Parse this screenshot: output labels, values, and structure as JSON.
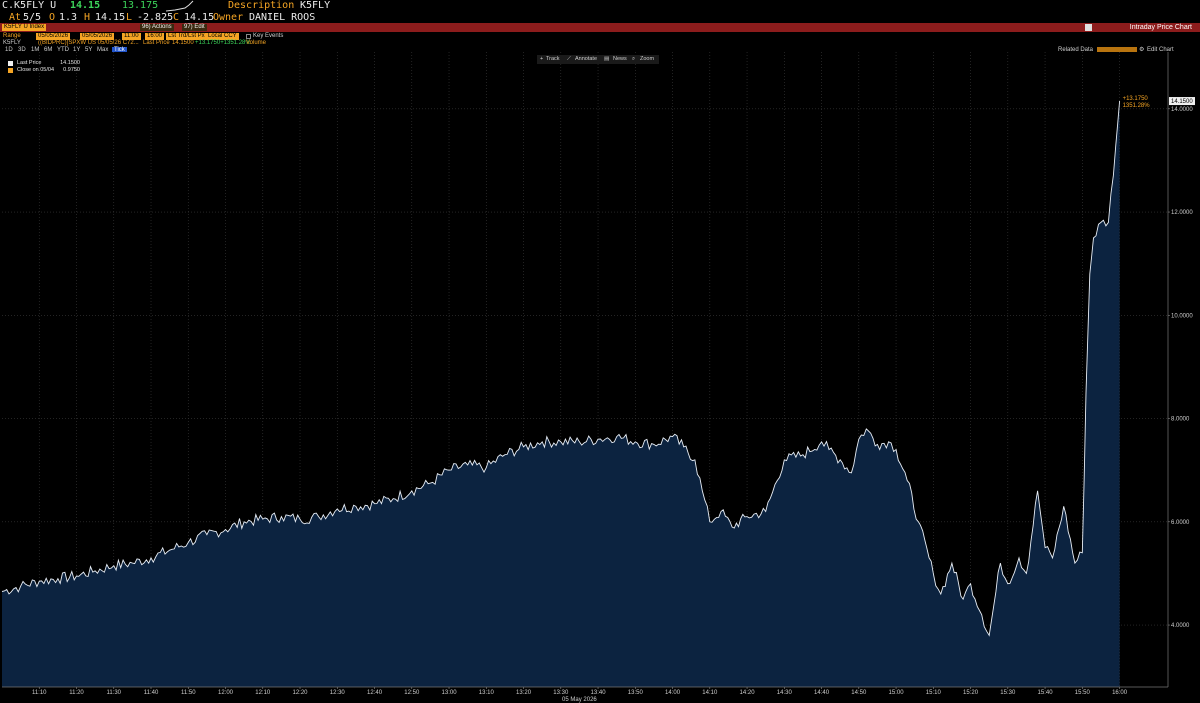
{
  "header": {
    "ticker": "C.K5FLY U",
    "last": "14.15",
    "change": "13.175",
    "desc_label": "Description",
    "desc_value": "K5FLY",
    "at_label": "At",
    "at_value": "5/5",
    "o_label": "O",
    "o_value": "1.3",
    "h_label": "H",
    "h_value": "14.15",
    "l_label": "L",
    "l_value": "-2.825",
    "c_label": "C",
    "c_value": "14.15",
    "owner_label": "Owner",
    "owner_value": "DANIEL ROOS"
  },
  "titlebar": {
    "security": "K5FLY U Index",
    "actions": "96) Actions",
    "edit": "97) Edit",
    "title": "Intraday Price Chart"
  },
  "toolbar": {
    "range_label": "Range",
    "start_date": "05/05/2026",
    "end_date": "05/05/2026",
    "start_time": "11:00",
    "end_time": "16:00",
    "last_price_sel": "Lst Trd/Lst Px",
    "ccy": "Local CCY",
    "key_events": "Key Events",
    "row_label": "K5FLY",
    "formula": "((BIDPRC)[SPXW US 05/05/26 C72...",
    "last_price_label": "Last Price",
    "last_price_val": "14.1500",
    "chg_text": "+13.1750+1351.28%",
    "volume_label": "Volume",
    "periods": [
      "1D",
      "3D",
      "1M",
      "6M",
      "YTD",
      "1Y",
      "5Y",
      "Max",
      "Tick"
    ],
    "related": "Related Data",
    "edit_chart": "Edit Chart"
  },
  "chart_tools": [
    "Track",
    "Annotate",
    "News",
    "Zoom"
  ],
  "legend": [
    {
      "name": "Last Price",
      "value": "14.1500",
      "color": "#f0f0f0"
    },
    {
      "name": "Close on 05/04",
      "value": "0.9750",
      "color": "#f5a524"
    }
  ],
  "colors": {
    "area": "#0c2340",
    "line": "#e8eef6",
    "amber": "#f5a524",
    "grid": "#3a3a3a"
  },
  "chart_data": {
    "type": "area",
    "xlabel": "05 May 2026",
    "x_ticks": [
      "11:10",
      "11:20",
      "11:30",
      "11:40",
      "11:50",
      "12:00",
      "12:10",
      "12:20",
      "12:30",
      "12:40",
      "12:50",
      "13:00",
      "13:10",
      "13:20",
      "13:30",
      "13:40",
      "13:50",
      "14:00",
      "14:10",
      "14:20",
      "14:30",
      "14:40",
      "14:50",
      "15:00",
      "15:10",
      "15:20",
      "15:30",
      "15:40",
      "15:50",
      "16:00"
    ],
    "y_ticks": [
      "4.0000",
      "6.0000",
      "8.0000",
      "10.0000",
      "12.0000",
      "14.0000"
    ],
    "ylim": [
      2.8,
      15.1
    ],
    "xlim": [
      "11:00",
      "16:13"
    ],
    "last_label": "14.1500",
    "annot_change": "+13.1750",
    "annot_pct": "1351.28%",
    "grid": true,
    "series": [
      {
        "name": "Last Price",
        "x": [
          "11:00",
          "11:05",
          "11:10",
          "11:15",
          "11:20",
          "11:25",
          "11:30",
          "11:35",
          "11:40",
          "11:45",
          "11:50",
          "11:55",
          "12:00",
          "12:05",
          "12:10",
          "12:15",
          "12:20",
          "12:25",
          "12:30",
          "12:35",
          "12:40",
          "12:45",
          "12:50",
          "12:55",
          "13:00",
          "13:05",
          "13:10",
          "13:15",
          "13:20",
          "13:25",
          "13:30",
          "13:35",
          "13:40",
          "13:45",
          "13:50",
          "13:55",
          "14:00",
          "14:03",
          "14:06",
          "14:08",
          "14:10",
          "14:13",
          "14:16",
          "14:20",
          "14:25",
          "14:30",
          "14:35",
          "14:40",
          "14:42",
          "14:45",
          "14:48",
          "14:50",
          "14:52",
          "14:55",
          "14:58",
          "15:00",
          "15:03",
          "15:06",
          "15:10",
          "15:12",
          "15:15",
          "15:18",
          "15:20",
          "15:23",
          "15:25",
          "15:28",
          "15:30",
          "15:33",
          "15:35",
          "15:38",
          "15:40",
          "15:42",
          "15:45",
          "15:48",
          "15:50",
          "15:51",
          "15:52",
          "15:53",
          "15:55",
          "15:57",
          "15:59",
          "16:00"
        ],
        "y": [
          4.65,
          4.75,
          4.85,
          4.9,
          4.95,
          5.05,
          5.15,
          5.2,
          5.3,
          5.45,
          5.6,
          5.75,
          5.85,
          6.0,
          6.05,
          6.1,
          6.05,
          6.1,
          6.25,
          6.3,
          6.35,
          6.45,
          6.6,
          6.75,
          7.0,
          7.1,
          7.05,
          7.3,
          7.45,
          7.55,
          7.55,
          7.55,
          7.6,
          7.65,
          7.55,
          7.5,
          7.65,
          7.45,
          7.2,
          6.6,
          6.0,
          6.2,
          5.9,
          6.1,
          6.2,
          7.2,
          7.3,
          7.55,
          7.4,
          7.2,
          6.95,
          7.6,
          7.8,
          7.5,
          7.55,
          7.4,
          6.8,
          6.0,
          5.0,
          4.6,
          5.2,
          4.5,
          4.8,
          4.2,
          3.8,
          5.2,
          4.8,
          5.3,
          5.0,
          6.6,
          5.5,
          5.3,
          6.3,
          5.2,
          5.4,
          8.5,
          10.8,
          11.5,
          11.8,
          11.8,
          13.3,
          14.15
        ]
      },
      {
        "name": "Close on 05/04",
        "value": 0.975
      }
    ]
  }
}
